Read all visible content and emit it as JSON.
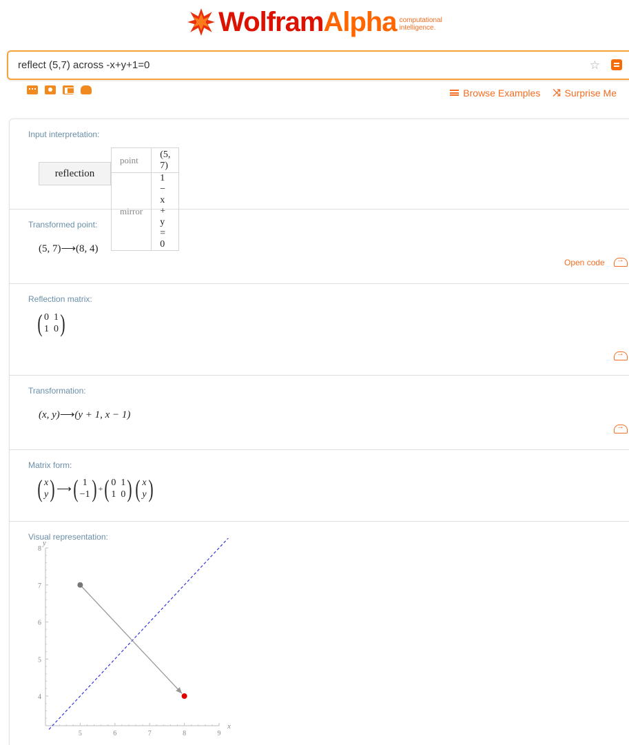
{
  "logo": {
    "wolfram": "Wolfram",
    "alpha": "Alpha",
    "tagline_1": "computational",
    "tagline_2": "intelligence."
  },
  "search": {
    "query": "reflect (5,7) across -x+y+1=0",
    "star_icon": "star-icon",
    "go_icon": "equals-icon"
  },
  "toolbar": {
    "icons": [
      "keyboard-icon",
      "camera-icon",
      "table-icon",
      "hand-icon"
    ],
    "browse_examples": "Browse Examples",
    "surprise_me": "Surprise Me"
  },
  "pods": {
    "input": {
      "title": "Input interpretation:",
      "head": "reflection",
      "rows": [
        {
          "key": "point",
          "value": "(5, 7)"
        },
        {
          "key": "mirror",
          "value": "1 − x + y = 0"
        }
      ]
    },
    "transformed": {
      "title": "Transformed point:",
      "expr_left": "(5, 7)",
      "arrow": "⟶",
      "expr_right": "(8, 4)",
      "open_code": "Open code"
    },
    "matrix": {
      "title": "Reflection matrix:",
      "r1": "0  1",
      "r2": "1  0"
    },
    "transformation": {
      "title": "Transformation:",
      "expr_left": "(x, y)",
      "arrow": "⟶",
      "expr_right": "(y + 1, x − 1)"
    },
    "matrix_form": {
      "title": "Matrix form:",
      "v1a": "x",
      "v1b": "y",
      "v2a": "1",
      "v2b": "−1",
      "plus": "+",
      "m1": "0  1",
      "m2": "1  0",
      "v3a": "x",
      "v3b": "y",
      "arrow": "⟶"
    },
    "visual": {
      "title": "Visual representation:"
    }
  },
  "chart_data": {
    "type": "scatter",
    "xlabel": "x",
    "ylabel": "y",
    "xlim": [
      4.0,
      9.0
    ],
    "ylim": [
      3.2,
      8.0
    ],
    "x_ticks": [
      5,
      6,
      7,
      8,
      9
    ],
    "y_ticks": [
      4,
      5,
      6,
      7,
      8
    ],
    "points": [
      {
        "x": 5,
        "y": 7,
        "color": "#777777"
      },
      {
        "x": 8,
        "y": 4,
        "color": "#dd0000"
      }
    ],
    "arrow": {
      "from": [
        5,
        7
      ],
      "to": [
        8,
        4
      ],
      "color": "#999999"
    },
    "mirror_line": {
      "equation": "y = x - 1",
      "from": [
        4.1,
        3.1
      ],
      "to": [
        9.5,
        8.5
      ],
      "color": "#3333dd",
      "style": "dashed"
    }
  }
}
